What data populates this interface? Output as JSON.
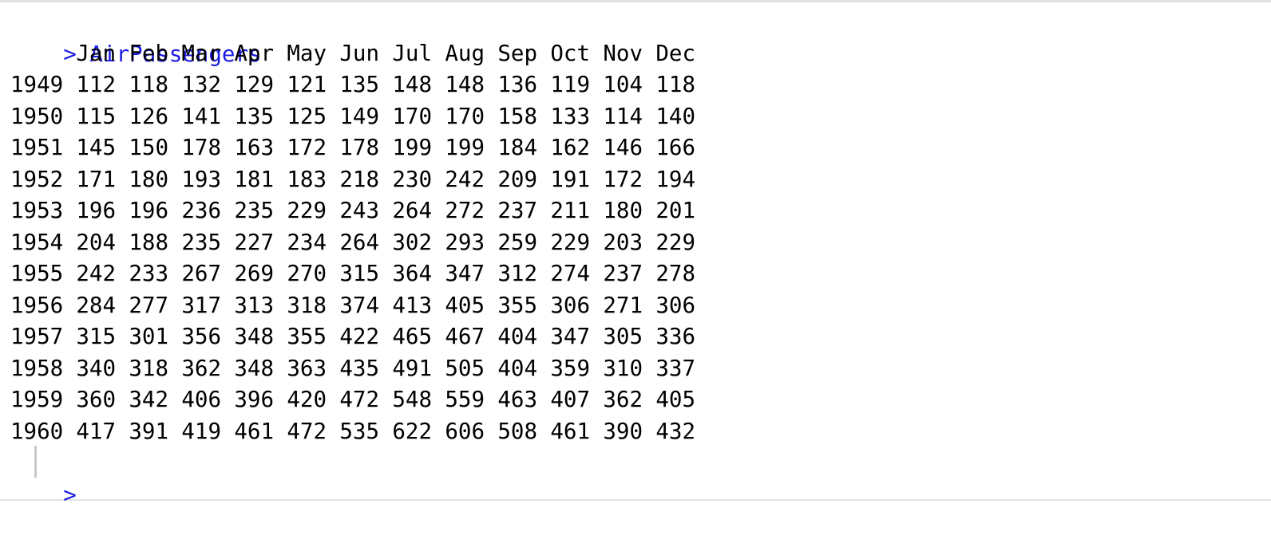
{
  "console": {
    "prompt_symbol": ">",
    "command": "AirPassengers",
    "months": [
      "Jan",
      "Feb",
      "Mar",
      "Apr",
      "May",
      "Jun",
      "Jul",
      "Aug",
      "Sep",
      "Oct",
      "Nov",
      "Dec"
    ],
    "rows": [
      {
        "year": "1949",
        "values": [
          "112",
          "118",
          "132",
          "129",
          "121",
          "135",
          "148",
          "148",
          "136",
          "119",
          "104",
          "118"
        ]
      },
      {
        "year": "1950",
        "values": [
          "115",
          "126",
          "141",
          "135",
          "125",
          "149",
          "170",
          "170",
          "158",
          "133",
          "114",
          "140"
        ]
      },
      {
        "year": "1951",
        "values": [
          "145",
          "150",
          "178",
          "163",
          "172",
          "178",
          "199",
          "199",
          "184",
          "162",
          "146",
          "166"
        ]
      },
      {
        "year": "1952",
        "values": [
          "171",
          "180",
          "193",
          "181",
          "183",
          "218",
          "230",
          "242",
          "209",
          "191",
          "172",
          "194"
        ]
      },
      {
        "year": "1953",
        "values": [
          "196",
          "196",
          "236",
          "235",
          "229",
          "243",
          "264",
          "272",
          "237",
          "211",
          "180",
          "201"
        ]
      },
      {
        "year": "1954",
        "values": [
          "204",
          "188",
          "235",
          "227",
          "234",
          "264",
          "302",
          "293",
          "259",
          "229",
          "203",
          "229"
        ]
      },
      {
        "year": "1955",
        "values": [
          "242",
          "233",
          "267",
          "269",
          "270",
          "315",
          "364",
          "347",
          "312",
          "274",
          "237",
          "278"
        ]
      },
      {
        "year": "1956",
        "values": [
          "284",
          "277",
          "317",
          "313",
          "318",
          "374",
          "413",
          "405",
          "355",
          "306",
          "271",
          "306"
        ]
      },
      {
        "year": "1957",
        "values": [
          "315",
          "301",
          "356",
          "348",
          "355",
          "422",
          "465",
          "467",
          "404",
          "347",
          "305",
          "336"
        ]
      },
      {
        "year": "1958",
        "values": [
          "340",
          "318",
          "362",
          "348",
          "363",
          "435",
          "491",
          "505",
          "404",
          "359",
          "310",
          "337"
        ]
      },
      {
        "year": "1959",
        "values": [
          "360",
          "342",
          "406",
          "396",
          "420",
          "472",
          "548",
          "559",
          "463",
          "407",
          "362",
          "405"
        ]
      },
      {
        "year": "1960",
        "values": [
          "417",
          "391",
          "419",
          "461",
          "472",
          "535",
          "622",
          "606",
          "508",
          "461",
          "390",
          "432"
        ]
      }
    ]
  },
  "colors": {
    "prompt": "#1a1ae6",
    "output_text": "#000000",
    "cursor": "#c8c8c8",
    "border": "#e3e3e3"
  }
}
